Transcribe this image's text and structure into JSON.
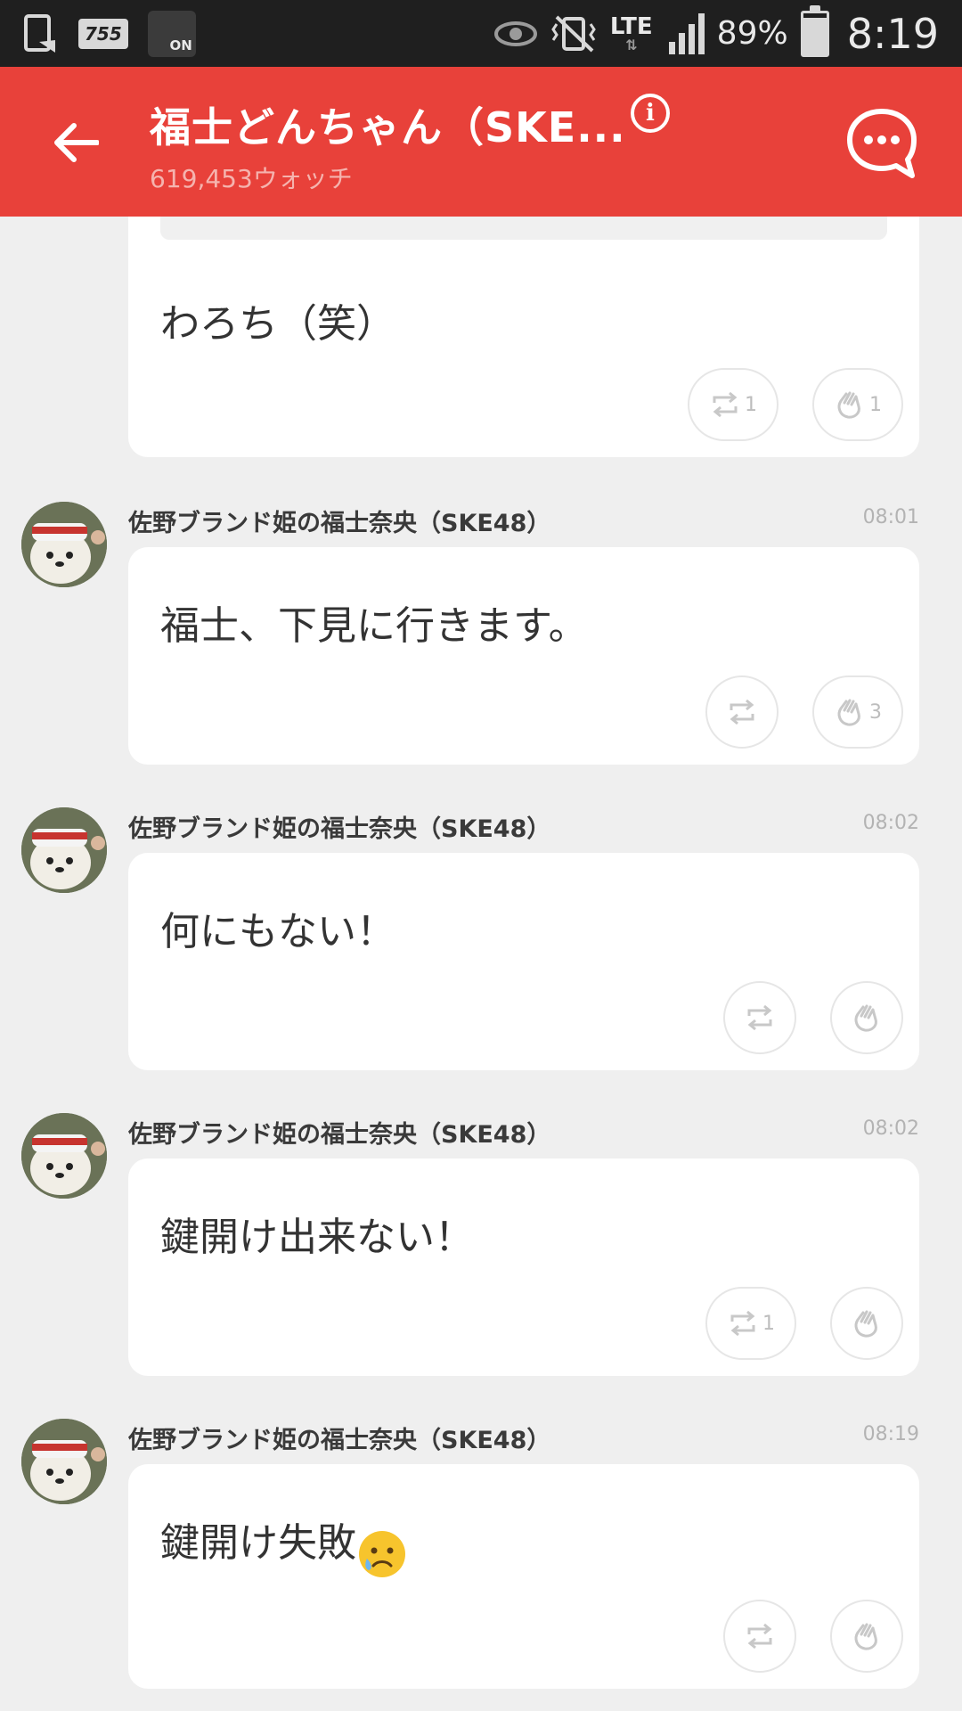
{
  "status_bar": {
    "tv_label": "755",
    "call_label": "ON",
    "network": "LTE",
    "battery": "89%",
    "time": "8:19"
  },
  "header": {
    "title": "福士どんちゃん（SKE...",
    "watch_count": "619,453ウォッチ",
    "colors": {
      "bar": "#e8413a",
      "watch_text": "#f5b3ae"
    }
  },
  "messages": [
    {
      "text": "わろち（笑）",
      "retweet_count": "1",
      "like_count": "1"
    },
    {
      "author": "佐野ブランド姫の福士奈央（SKE48）",
      "time": "08:01",
      "text": "福士、下見に行きます。",
      "retweet_count": "",
      "like_count": "3"
    },
    {
      "author": "佐野ブランド姫の福士奈央（SKE48）",
      "time": "08:02",
      "text": "何にもない！",
      "retweet_count": "",
      "like_count": ""
    },
    {
      "author": "佐野ブランド姫の福士奈央（SKE48）",
      "time": "08:02",
      "text": "鍵開け出来ない！",
      "retweet_count": "1",
      "like_count": ""
    },
    {
      "author": "佐野ブランド姫の福士奈央（SKE48）",
      "time": "08:19",
      "text": "鍵開け失敗",
      "emoji": "sad-face-tear-emoji",
      "retweet_count": "",
      "like_count": ""
    }
  ]
}
